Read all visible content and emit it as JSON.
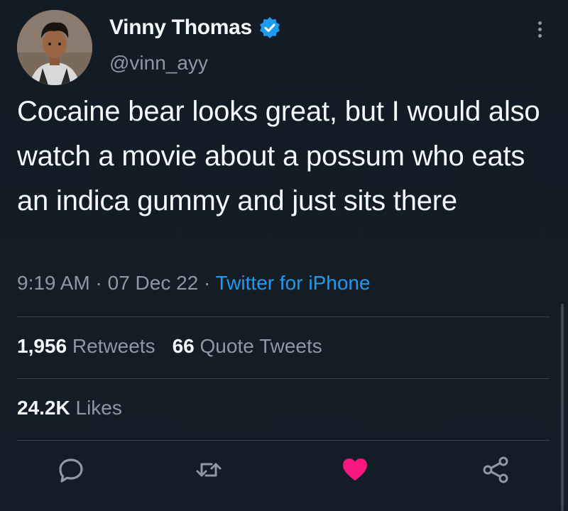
{
  "author": {
    "name": "Vinny Thomas",
    "handle": "@vinn_ayy"
  },
  "tweet": {
    "text": "Cocaine bear looks great, but I would also watch a movie about a possum who eats an indica gummy and just sits there",
    "time": "9:19 AM",
    "date": "07 Dec 22",
    "separator": "·",
    "source": "Twitter for iPhone"
  },
  "stats": {
    "retweets_count": "1,956",
    "retweets_label": "Retweets",
    "quotes_count": "66",
    "quotes_label": "Quote Tweets",
    "likes_count": "24.2K",
    "likes_label": "Likes"
  },
  "actions": {
    "reply_icon": "reply-icon",
    "retweet_icon": "retweet-icon",
    "like_icon": "heart-icon",
    "share_icon": "share-icon"
  },
  "colors": {
    "background": "#15202b",
    "link": "#1d9bf0",
    "like": "#f91880",
    "muted": "#8b98a5"
  }
}
